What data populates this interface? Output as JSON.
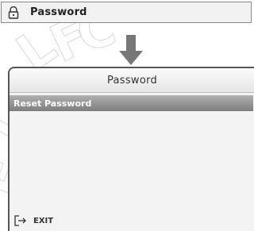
{
  "breadcrumb": {
    "icon": "lock-icon",
    "label": "Password"
  },
  "arrow": {
    "icon": "arrow-down-icon"
  },
  "device_screen": {
    "title": "Password",
    "menu": [
      {
        "label": "Reset Password",
        "selected": true
      }
    ],
    "exit": {
      "icon": "exit-icon",
      "label": "EXIT"
    }
  },
  "watermark": {
    "text": "LFC"
  },
  "colors": {
    "selection_bar": "#8a8a8a",
    "arrow": "#777777",
    "screen_background": "#f3f3f3"
  }
}
